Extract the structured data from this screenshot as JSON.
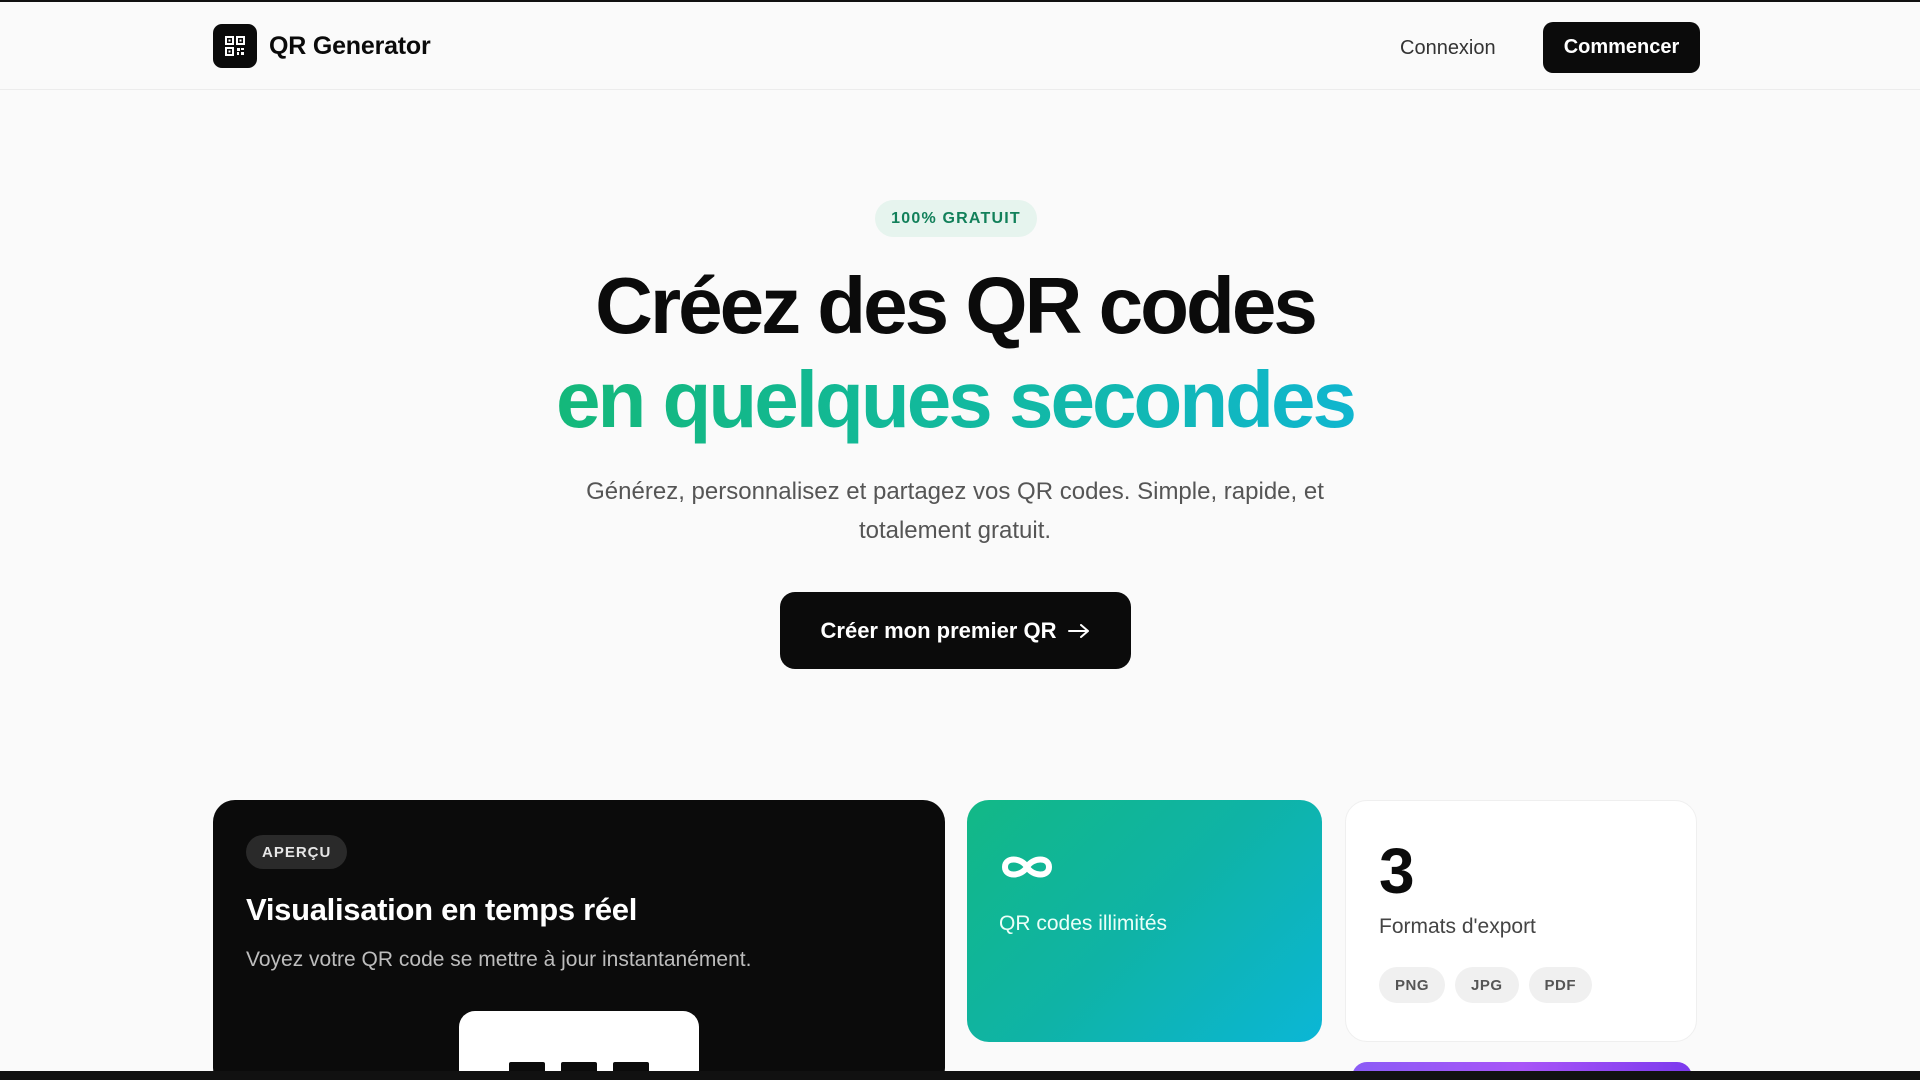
{
  "header": {
    "brand_name": "QR Generator",
    "login_label": "Connexion",
    "cta_label": "Commencer"
  },
  "hero": {
    "badge": "100% GRATUIT",
    "title_line1": "Créez des QR codes",
    "title_line2": "en quelques secondes",
    "subtitle": "Générez, personnalisez et partagez vos QR codes. Simple, rapide, et totalement gratuit.",
    "cta_label": "Créer mon premier QR",
    "cta_icon": "arrow-right-icon"
  },
  "cards": {
    "preview": {
      "badge": "APERÇU",
      "title": "Visualisation en temps réel",
      "description": "Voyez votre QR code se mettre à jour instantanément."
    },
    "unlimited": {
      "icon": "infinity-icon",
      "label": "QR codes illimités"
    },
    "formats": {
      "count": "3",
      "label": "Formats d'export",
      "chips": [
        "PNG",
        "JPG",
        "PDF"
      ]
    }
  },
  "colors": {
    "accent_green": "#14b87a",
    "accent_cyan": "#10b6cf",
    "dark": "#0b0b0b",
    "badge_bg": "#e6f4ee",
    "purple": "#8b5cf6"
  }
}
